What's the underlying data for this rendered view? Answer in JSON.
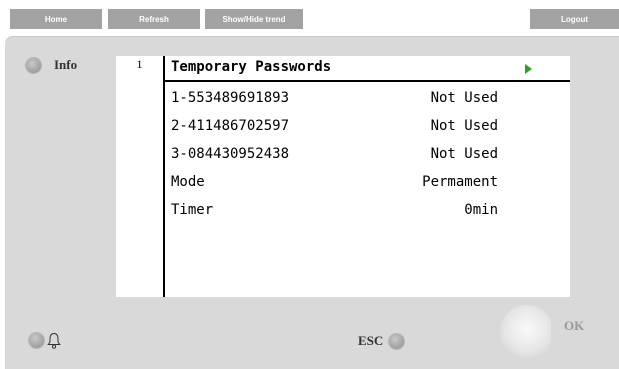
{
  "nav": {
    "home": "Home",
    "refresh": "Refresh",
    "trend": "Show/Hide trend",
    "logout": "Logout"
  },
  "panel": {
    "info_label": "Info",
    "esc_label": "ESC",
    "ok_label": "OK"
  },
  "screen": {
    "line_number": "1",
    "title": "Temporary Passwords",
    "rows": [
      {
        "label": "1-553489691893",
        "value": "Not Used"
      },
      {
        "label": "2-411486702597",
        "value": "Not Used"
      },
      {
        "label": "3-084430952438",
        "value": "Not Used"
      },
      {
        "label": "Mode",
        "value": "Permament"
      },
      {
        "label": "Timer",
        "value": "0min"
      }
    ]
  },
  "icons": {
    "bell": "bell-icon",
    "next": "play-arrow-icon"
  },
  "colors": {
    "nav_button": "#a3a3a3",
    "panel": "#d9d9d9",
    "arrow": "#2f9e2f"
  }
}
